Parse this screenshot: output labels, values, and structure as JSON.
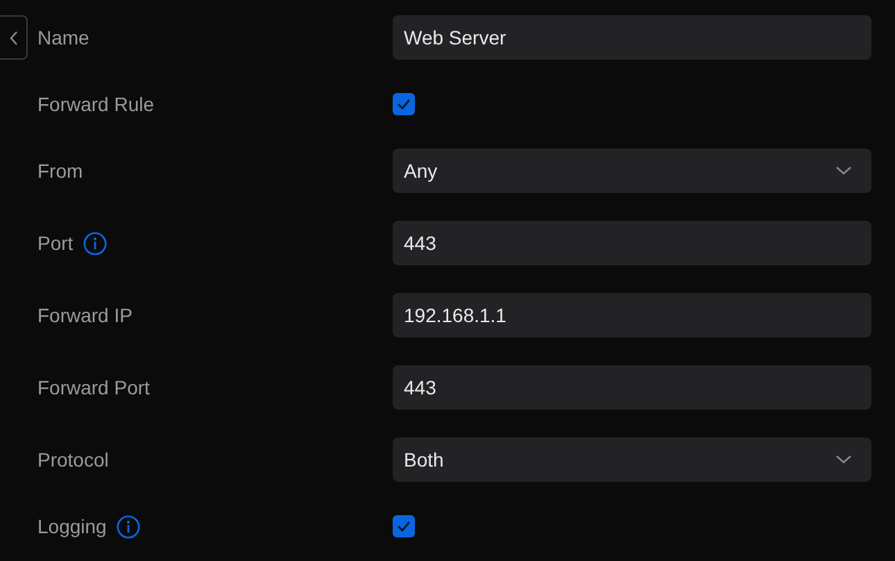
{
  "fields": [
    {
      "label": "Name",
      "kind": "text",
      "value": "Web Server",
      "info": false
    },
    {
      "label": "Forward Rule",
      "kind": "checkbox",
      "checked": true,
      "info": false
    },
    {
      "label": "From",
      "kind": "select",
      "value": "Any",
      "info": false
    },
    {
      "label": "Port",
      "kind": "text",
      "value": "443",
      "info": true
    },
    {
      "label": "Forward IP",
      "kind": "text",
      "value": "192.168.1.1",
      "info": false
    },
    {
      "label": "Forward Port",
      "kind": "text",
      "value": "443",
      "info": false
    },
    {
      "label": "Protocol",
      "kind": "select",
      "value": "Both",
      "info": false
    },
    {
      "label": "Logging",
      "kind": "checkbox",
      "checked": true,
      "info": true
    }
  ]
}
